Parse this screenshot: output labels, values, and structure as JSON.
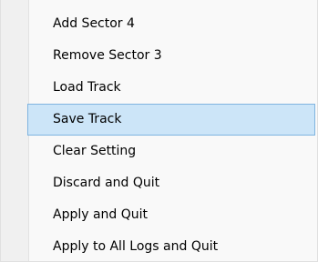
{
  "context_menu": {
    "selected_index": 3,
    "items": [
      {
        "label": "Add Sector 4"
      },
      {
        "label": "Remove Sector 3"
      },
      {
        "label": "Load Track"
      },
      {
        "label": "Save Track"
      },
      {
        "label": "Clear Setting"
      },
      {
        "label": "Discard and Quit"
      },
      {
        "label": "Apply and Quit"
      },
      {
        "label": "Apply to All Logs and Quit"
      }
    ],
    "colors": {
      "highlight_fill": "#cce5f8",
      "highlight_border": "#7fb4e0",
      "menu_background": "#f9f9f9",
      "gutter_background": "#f0f0f0"
    }
  }
}
